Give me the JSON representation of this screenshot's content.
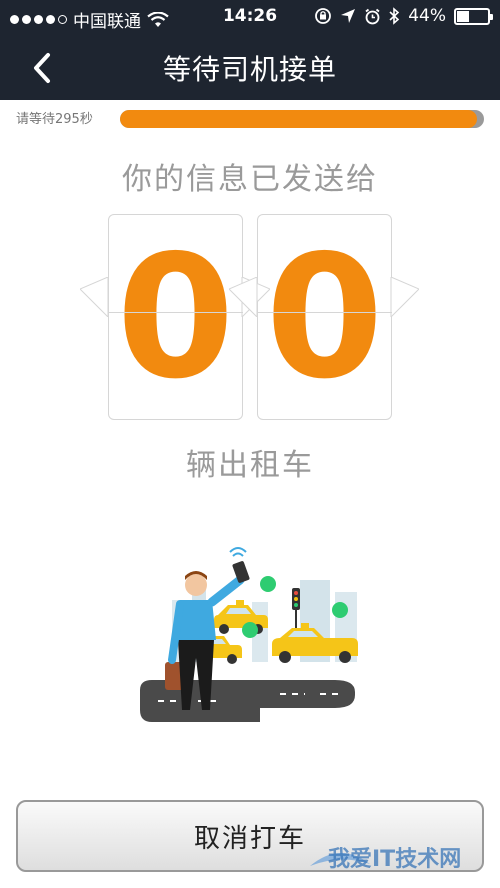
{
  "status_bar": {
    "carrier": "中国联通",
    "time": "14:26",
    "battery": "44%",
    "battery_level": 0.44,
    "signal_bars_filled": 4,
    "signal_bars_total": 5
  },
  "nav": {
    "back_icon": "chevron-left-icon",
    "title": "等待司机接单"
  },
  "waiting": {
    "countdown_text": "请等待295秒",
    "progress": 0.98
  },
  "message": {
    "line1": "你的信息已发送给",
    "count_digits": [
      "0",
      "0"
    ],
    "line2": "辆出租车"
  },
  "illustration": {
    "icon": "person-hailing-taxi-illustration"
  },
  "actions": {
    "cancel_label": "取消打车"
  },
  "colors": {
    "header_bg": "#1e2530",
    "accent_orange": "#f28a0f",
    "text_gray": "#9a9a9a"
  },
  "watermark": {
    "text": "我爱IT技术网"
  }
}
